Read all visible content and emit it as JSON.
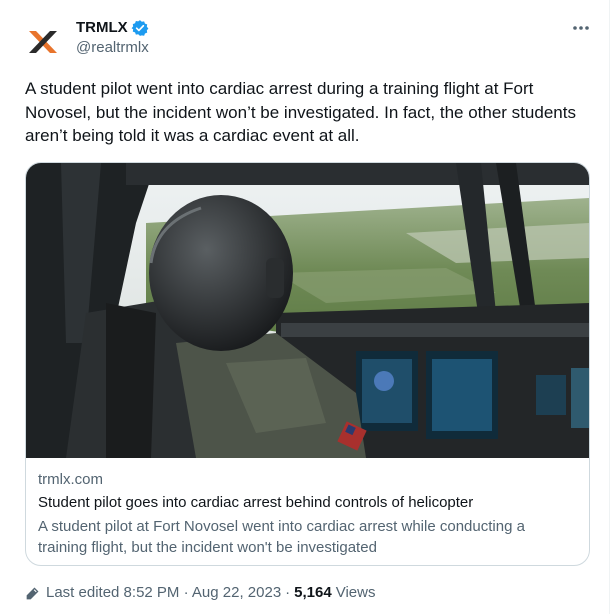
{
  "author": {
    "name": "TRMLX",
    "handle": "@realtrmlx",
    "verified": true
  },
  "tweet": {
    "text": "A student pilot went into cardiac arrest during a training flight at Fort Novosel, but the incident won’t be investigated. In fact, the other students aren’t being told it was a cardiac event at all."
  },
  "link_card": {
    "domain": "trmlx.com",
    "title": "Student pilot goes into cardiac arrest behind controls of helicopter",
    "description": "A student pilot at Fort Novosel went into cardiac arrest while conducting a training flight, but the incident won't be investigated",
    "image_icon": "helicopter-cockpit-photo"
  },
  "footer": {
    "edited_label": "Last edited 8:52 PM · Aug 22, 2023",
    "separator": "·",
    "views_count": "5,164",
    "views_label": "Views"
  },
  "icons": {
    "more": "more-dots-icon",
    "edit": "pencil-edit-icon",
    "verified": "verified-badge-icon"
  },
  "colors": {
    "text_primary": "#0f1419",
    "text_secondary": "#536471",
    "verified_blue": "#1d9bf0",
    "border": "#cfd9de",
    "logo_orange": "#e8742c"
  }
}
